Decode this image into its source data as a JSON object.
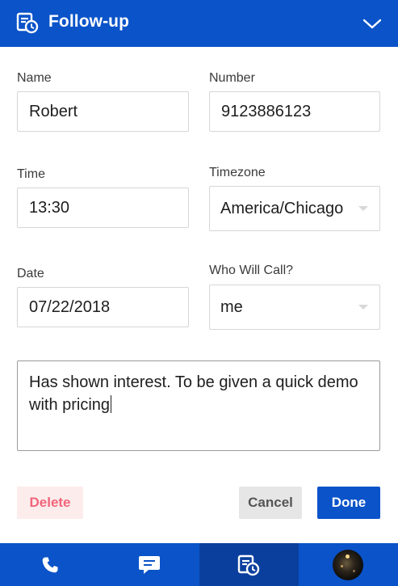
{
  "header": {
    "title": "Follow-up",
    "icon": "calendar-clock-icon",
    "collapse_icon": "chevron-down-icon"
  },
  "form": {
    "name": {
      "label": "Name",
      "value": "Robert"
    },
    "number": {
      "label": "Number",
      "value": "9123886123"
    },
    "time": {
      "label": "Time",
      "value": "13:30"
    },
    "timezone": {
      "label": "Timezone",
      "value": "America/Chicago"
    },
    "date": {
      "label": "Date",
      "value": "07/22/2018"
    },
    "caller": {
      "label": "Who Will Call?",
      "value": "me"
    },
    "notes": {
      "value": "Has shown interest. To be given a quick demo with pricing"
    }
  },
  "actions": {
    "delete_label": "Delete",
    "cancel_label": "Cancel",
    "done_label": "Done"
  },
  "bottom_nav": {
    "items": [
      {
        "icon": "phone-icon"
      },
      {
        "icon": "chat-icon"
      },
      {
        "icon": "calendar-clock-icon",
        "active": true
      },
      {
        "icon": "avatar"
      }
    ]
  },
  "colors": {
    "primary": "#0a53c9",
    "active_nav": "#0a3f9e",
    "delete_text": "#f0657b",
    "delete_bg": "#fdecec"
  }
}
